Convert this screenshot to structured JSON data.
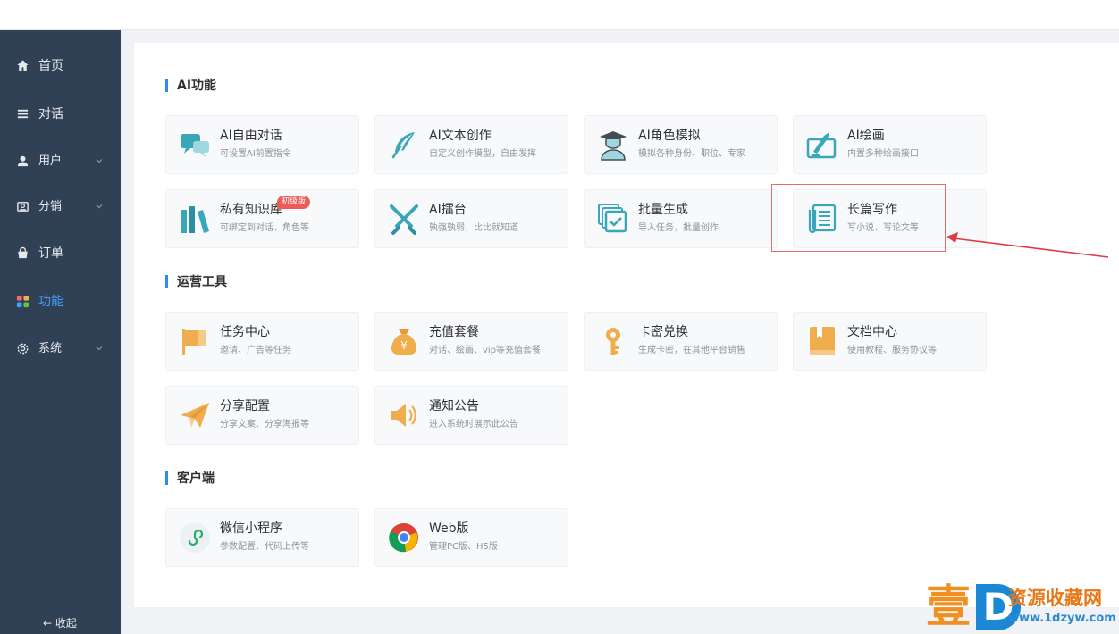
{
  "sidebar": {
    "items": [
      {
        "label": "首页",
        "icon": "home-icon"
      },
      {
        "label": "对话",
        "icon": "list-icon"
      },
      {
        "label": "用户",
        "icon": "user-icon",
        "expandable": true
      },
      {
        "label": "分销",
        "icon": "distribution-icon",
        "expandable": true
      },
      {
        "label": "订单",
        "icon": "order-icon"
      },
      {
        "label": "功能",
        "icon": "apps-icon",
        "active": true
      },
      {
        "label": "系统",
        "icon": "gear-icon",
        "expandable": true
      }
    ],
    "collapse_label": "← 收起"
  },
  "sections": [
    {
      "title": "AI功能",
      "cards": [
        {
          "title": "AI自由对话",
          "desc": "可设置AI前置指令",
          "icon": "chat-bubbles-icon"
        },
        {
          "title": "AI文本创作",
          "desc": "自定义创作模型，自由发挥",
          "icon": "feather-icon"
        },
        {
          "title": "AI角色模拟",
          "desc": "模拟各种身份、职位、专家",
          "icon": "graduate-icon"
        },
        {
          "title": "AI绘画",
          "desc": "内置多种绘画接口",
          "icon": "paint-icon"
        },
        {
          "title": "私有知识库",
          "desc": "可绑定到对话、角色等",
          "icon": "books-icon",
          "badge": "初级版"
        },
        {
          "title": "AI擂台",
          "desc": "孰强孰弱，比比就知道",
          "icon": "crossed-swords-icon"
        },
        {
          "title": "批量生成",
          "desc": "导入任务，批量创作",
          "icon": "batch-check-icon"
        },
        {
          "title": "长篇写作",
          "desc": "写小说、写论文等",
          "icon": "scroll-icon"
        }
      ]
    },
    {
      "title": "运营工具",
      "cards": [
        {
          "title": "任务中心",
          "desc": "邀请、广告等任务",
          "icon": "flag-icon"
        },
        {
          "title": "充值套餐",
          "desc": "对话、绘画、vip等充值套餐",
          "icon": "money-bag-icon"
        },
        {
          "title": "卡密兑换",
          "desc": "生成卡密，在其他平台销售",
          "icon": "key-icon"
        },
        {
          "title": "文档中心",
          "desc": "使用教程、服务协议等",
          "icon": "document-book-icon"
        },
        {
          "title": "分享配置",
          "desc": "分享文案、分享海报等",
          "icon": "paper-plane-icon"
        },
        {
          "title": "通知公告",
          "desc": "进入系统时展示此公告",
          "icon": "speaker-icon"
        }
      ]
    },
    {
      "title": "客户端",
      "cards": [
        {
          "title": "微信小程序",
          "desc": "参数配置、代码上传等",
          "icon": "mini-program-icon"
        },
        {
          "title": "Web版",
          "desc": "管理PC版、H5版",
          "icon": "chrome-icon"
        }
      ]
    }
  ],
  "colors": {
    "sidebar_bg": "#304156",
    "accent": "#2d8cf0",
    "active": "#409eff",
    "highlight": "#e86a6a",
    "icon_teal": "#3aa6b9",
    "icon_orange": "#f0ad4e"
  },
  "watermark": {
    "glyph": "壹",
    "letter": "D",
    "text": "资源收藏网",
    "url": "www.1dzyw.com"
  }
}
